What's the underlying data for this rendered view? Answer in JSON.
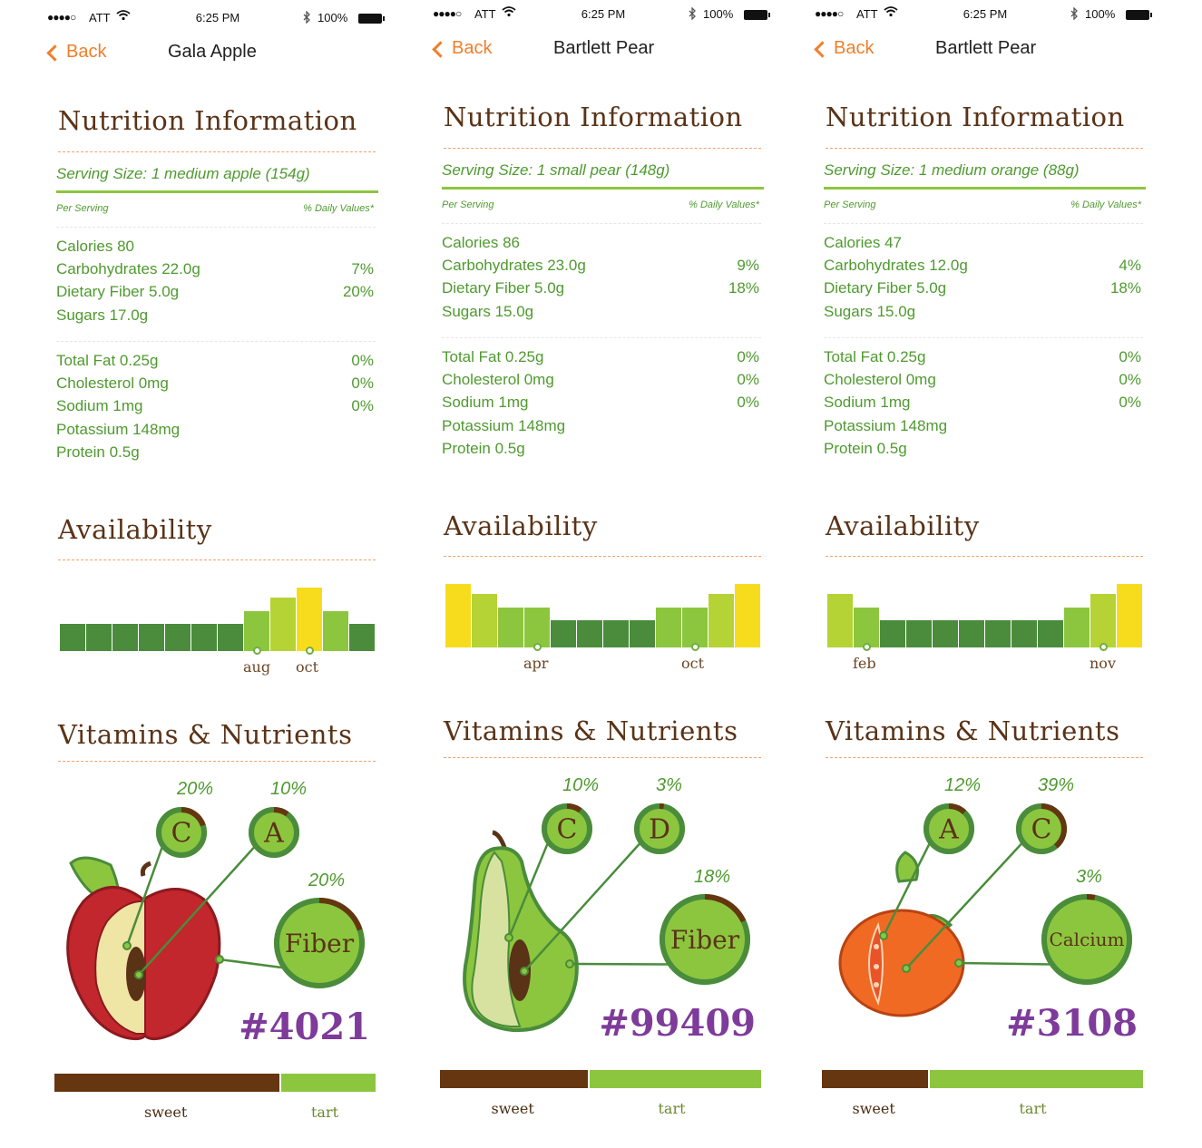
{
  "status": {
    "carrier": "ATT",
    "signal": "●●●●○",
    "wifi_icon": "wifi-icon",
    "time": "6:25 PM",
    "bluetooth_icon": "bluetooth-icon",
    "battery": "100%"
  },
  "colors": {
    "accent": "#ef7f2b",
    "green": "#4f9a2f",
    "brown": "#5a3317",
    "purple": "#7e3b9a"
  },
  "screens": [
    {
      "back": "Back",
      "title": "Gala Apple",
      "nutrition_heading": "Nutrition Information",
      "serving": "Serving Size: 1 medium apple (154g)",
      "per_serving": "Per Serving",
      "daily_values": "% Daily Values*",
      "group1": [
        {
          "label": "Calories  80",
          "value": ""
        },
        {
          "label": "Carbohydrates  22.0g",
          "value": "7%"
        },
        {
          "label": "Dietary Fiber  5.0g",
          "value": "20%"
        },
        {
          "label": "Sugars  17.0g",
          "value": ""
        }
      ],
      "group2": [
        {
          "label": "Total Fat  0.25g",
          "value": "0%"
        },
        {
          "label": "Cholesterol  0mg",
          "value": "0%"
        },
        {
          "label": "Sodium  1mg",
          "value": "0%"
        },
        {
          "label": "Potassium  148mg",
          "value": ""
        },
        {
          "label": "Protein  0.5g",
          "value": ""
        }
      ],
      "availability_heading": "Availability",
      "availability_levels": [
        1,
        1,
        1,
        1,
        1,
        1,
        1,
        2,
        3,
        4,
        2,
        1
      ],
      "availability_markers": [
        {
          "label": "aug",
          "month": 7
        },
        {
          "label": "oct",
          "month": 9
        }
      ],
      "vitamins_heading": "Vitamins & Nutrients",
      "nutrients": [
        {
          "letter": "C",
          "pct": "20%",
          "fraction": 0.2
        },
        {
          "letter": "A",
          "pct": "10%",
          "fraction": 0.1
        },
        {
          "letter": "Fiber",
          "pct": "20%",
          "fraction": 0.2
        }
      ],
      "plu": "#4021",
      "sweet_fraction": 0.7,
      "sweet": "sweet",
      "tart": "tart"
    },
    {
      "back": "Back",
      "title": "Bartlett Pear",
      "nutrition_heading": "Nutrition Information",
      "serving": "Serving Size: 1 small pear (148g)",
      "per_serving": "Per Serving",
      "daily_values": "% Daily Values*",
      "group1": [
        {
          "label": "Calories  86",
          "value": ""
        },
        {
          "label": "Carbohydrates  23.0g",
          "value": "9%"
        },
        {
          "label": "Dietary Fiber  5.0g",
          "value": "18%"
        },
        {
          "label": "Sugars  15.0g",
          "value": ""
        }
      ],
      "group2": [
        {
          "label": "Total Fat  0.25g",
          "value": "0%"
        },
        {
          "label": "Cholesterol  0mg",
          "value": "0%"
        },
        {
          "label": "Sodium  1mg",
          "value": "0%"
        },
        {
          "label": "Potassium  148mg",
          "value": ""
        },
        {
          "label": "Protein  0.5g",
          "value": ""
        }
      ],
      "availability_heading": "Availability",
      "availability_levels": [
        4,
        3,
        2,
        2,
        1,
        1,
        1,
        1,
        2,
        2,
        3,
        4
      ],
      "availability_markers": [
        {
          "label": "apr",
          "month": 3
        },
        {
          "label": "oct",
          "month": 9
        }
      ],
      "vitamins_heading": "Vitamins & Nutrients",
      "nutrients": [
        {
          "letter": "C",
          "pct": "10%",
          "fraction": 0.1
        },
        {
          "letter": "D",
          "pct": "3%",
          "fraction": 0.03
        },
        {
          "letter": "Fiber",
          "pct": "18%",
          "fraction": 0.18
        }
      ],
      "plu": "#99409",
      "sweet_fraction": 0.46,
      "sweet": "sweet",
      "tart": "tart"
    },
    {
      "back": "Back",
      "title": "Bartlett Pear",
      "nutrition_heading": "Nutrition Information",
      "serving": "Serving Size: 1 medium orange (88g)",
      "per_serving": "Per Serving",
      "daily_values": "% Daily Values*",
      "group1": [
        {
          "label": "Calories  47",
          "value": ""
        },
        {
          "label": "Carbohydrates  12.0g",
          "value": "4%"
        },
        {
          "label": "Dietary Fiber  5.0g",
          "value": "18%"
        },
        {
          "label": "Sugars  15.0g",
          "value": ""
        }
      ],
      "group2": [
        {
          "label": "Total Fat  0.25g",
          "value": "0%"
        },
        {
          "label": "Cholesterol  0mg",
          "value": "0%"
        },
        {
          "label": "Sodium  1mg",
          "value": "0%"
        },
        {
          "label": "Potassium  148mg",
          "value": ""
        },
        {
          "label": "Protein  0.5g",
          "value": ""
        }
      ],
      "availability_heading": "Availability",
      "availability_levels": [
        3,
        2,
        1,
        1,
        1,
        1,
        1,
        1,
        1,
        2,
        3,
        4
      ],
      "availability_markers": [
        {
          "label": "feb",
          "month": 1
        },
        {
          "label": "nov",
          "month": 10
        }
      ],
      "vitamins_heading": "Vitamins & Nutrients",
      "nutrients": [
        {
          "letter": "A",
          "pct": "12%",
          "fraction": 0.12
        },
        {
          "letter": "C",
          "pct": "39%",
          "fraction": 0.39
        },
        {
          "letter": "Calcium",
          "pct": "3%",
          "fraction": 0.03
        }
      ],
      "plu": "#3108",
      "sweet_fraction": 0.33,
      "sweet": "sweet",
      "tart": "tart"
    }
  ]
}
